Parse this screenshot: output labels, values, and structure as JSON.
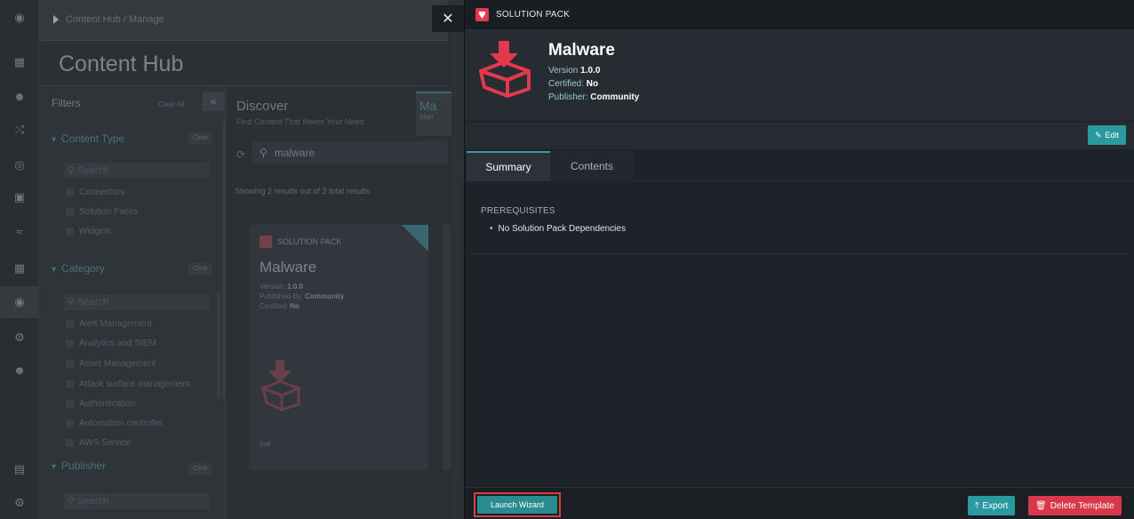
{
  "background": {
    "breadcrumb": "Content Hub / Manage",
    "page_title": "Content Hub",
    "filters": {
      "title": "Filters",
      "clear_all": "Clear All",
      "clear": "Clear",
      "search_placeholder": "Search",
      "content_type": {
        "label": "Content Type",
        "options": [
          "Connectors",
          "Solution Packs",
          "Widgets"
        ]
      },
      "category": {
        "label": "Category",
        "options": [
          "Alert Management",
          "Analytics and SIEM",
          "Asset Management",
          "Attack surface management",
          "Authentication",
          "Automation controller",
          "AWS Service"
        ]
      },
      "publisher": {
        "label": "Publisher"
      }
    },
    "tabs": {
      "discover": {
        "title": "Discover",
        "subtitle": "Find Content That Meets Your Need"
      },
      "manage": {
        "title": "Ma",
        "subtitle": "Man"
      }
    },
    "search_value": "malware",
    "showing": "Showing 2 results out of 2 total results",
    "card": {
      "type": "SOLUTION PACK",
      "name": "Malware",
      "version_label": "Version: ",
      "version": "1.0.0",
      "published_label": "Published By: ",
      "published_by": "Community",
      "certified_label": "Certified: ",
      "certified": "No",
      "footer": "null"
    }
  },
  "drawer": {
    "header_label": "SOLUTION PACK",
    "name": "Malware",
    "version_label": "Version ",
    "version": "1.0.0",
    "certified_label": "Certified: ",
    "certified": "No",
    "publisher_label": "Publisher: ",
    "publisher": "Community",
    "edit_label": "Edit",
    "tabs": {
      "summary": "Summary",
      "contents": "Contents"
    },
    "prerequisites_heading": "PREREQUISITES",
    "prerequisites_items": [
      "No Solution Pack Dependencies"
    ],
    "footer": {
      "launch_label": "Launch Wizard",
      "export_label": "Export",
      "delete_label": "Delete Template"
    }
  },
  "colors": {
    "accent": "#2a9aa0",
    "danger": "#d8384a",
    "badge": "#e3394f",
    "highlight_box": "#d6403f"
  },
  "icons": [
    "close-icon",
    "box-download-icon",
    "edit-icon",
    "export-icon",
    "trash-icon",
    "refresh-icon",
    "search-icon",
    "collapse-icon"
  ]
}
